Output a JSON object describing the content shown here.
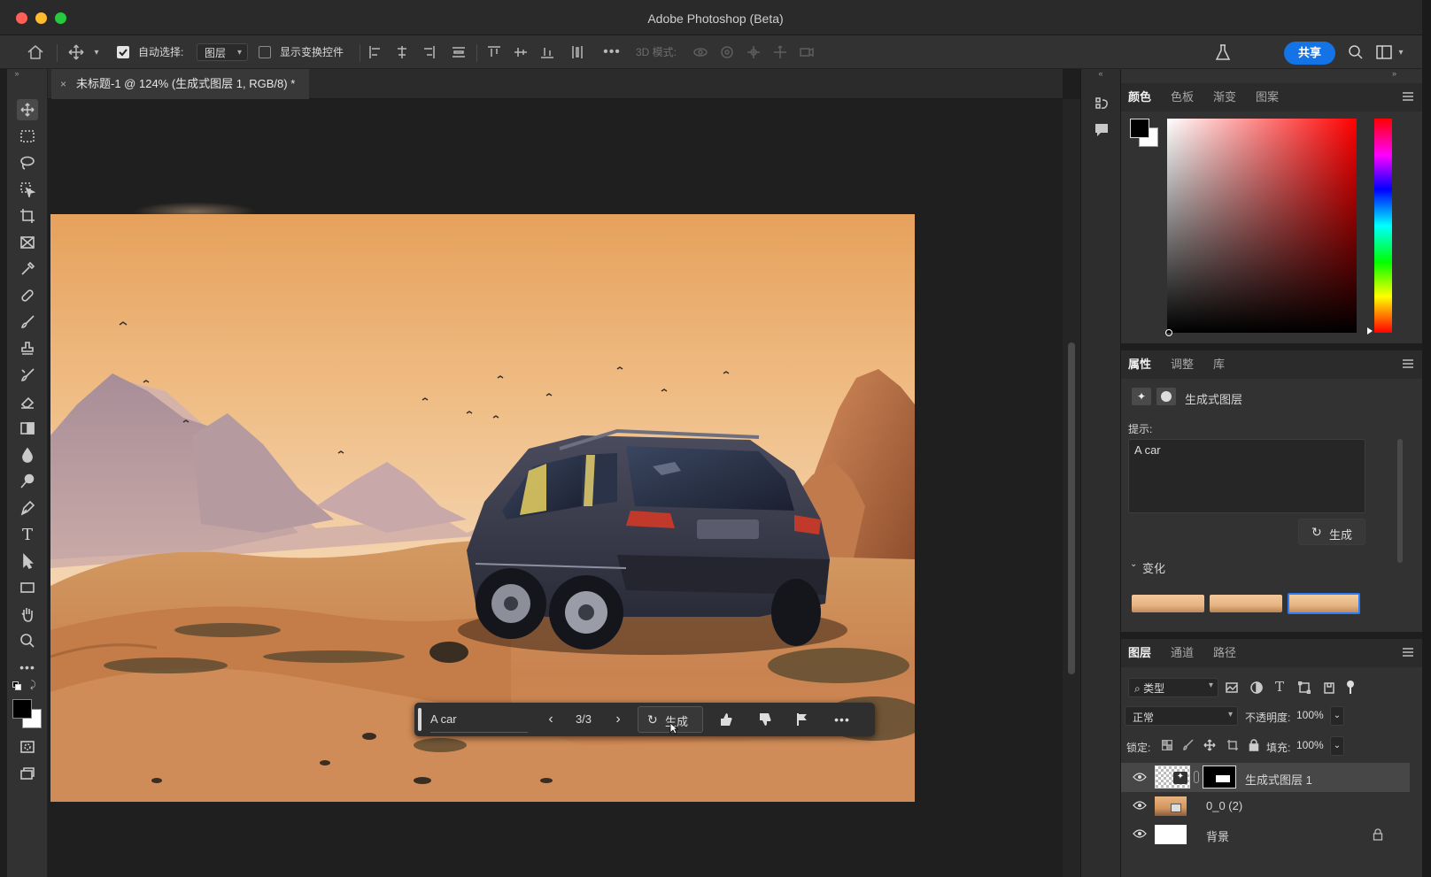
{
  "window": {
    "title": "Adobe Photoshop (Beta)"
  },
  "options_bar": {
    "auto_select_label": "自动选择:",
    "auto_select_value": "图层",
    "show_transform_label": "显示变换控件",
    "mode_3d_label": "3D 模式:",
    "share_label": "共享"
  },
  "document": {
    "tab_title": "未标题-1 @ 124% (生成式图层 1, RGB/8) *",
    "close_glyph": "×"
  },
  "contextual_task_bar": {
    "prompt_value": "A car",
    "counter": "3/3",
    "generate_label": "生成"
  },
  "color_panel": {
    "tabs": [
      "颜色",
      "色板",
      "渐变",
      "图案"
    ],
    "active_tab": "颜色",
    "foreground": "#000000",
    "background": "#ffffff"
  },
  "properties_panel": {
    "tabs": [
      "属性",
      "调整",
      "库"
    ],
    "layer_type_label": "生成式图层",
    "prompt_label": "提示:",
    "prompt_value": "A car",
    "generate_label": "生成",
    "variations_label": "变化"
  },
  "layers_panel": {
    "tabs": [
      "图层",
      "通道",
      "路径"
    ],
    "filter_label": "类型",
    "blend_mode": "正常",
    "opacity_label": "不透明度:",
    "opacity_value": "100%",
    "lock_label": "锁定:",
    "fill_label": "填充:",
    "fill_value": "100%",
    "layers": [
      {
        "name": "生成式图层 1",
        "selected": true
      },
      {
        "name": "0_0 (2)",
        "selected": false
      },
      {
        "name": "背景",
        "selected": false,
        "locked": true
      }
    ]
  },
  "colors": {
    "accent": "#1473e6",
    "close": "#ff5f57",
    "minimize": "#febc2e",
    "zoom": "#28c840"
  }
}
